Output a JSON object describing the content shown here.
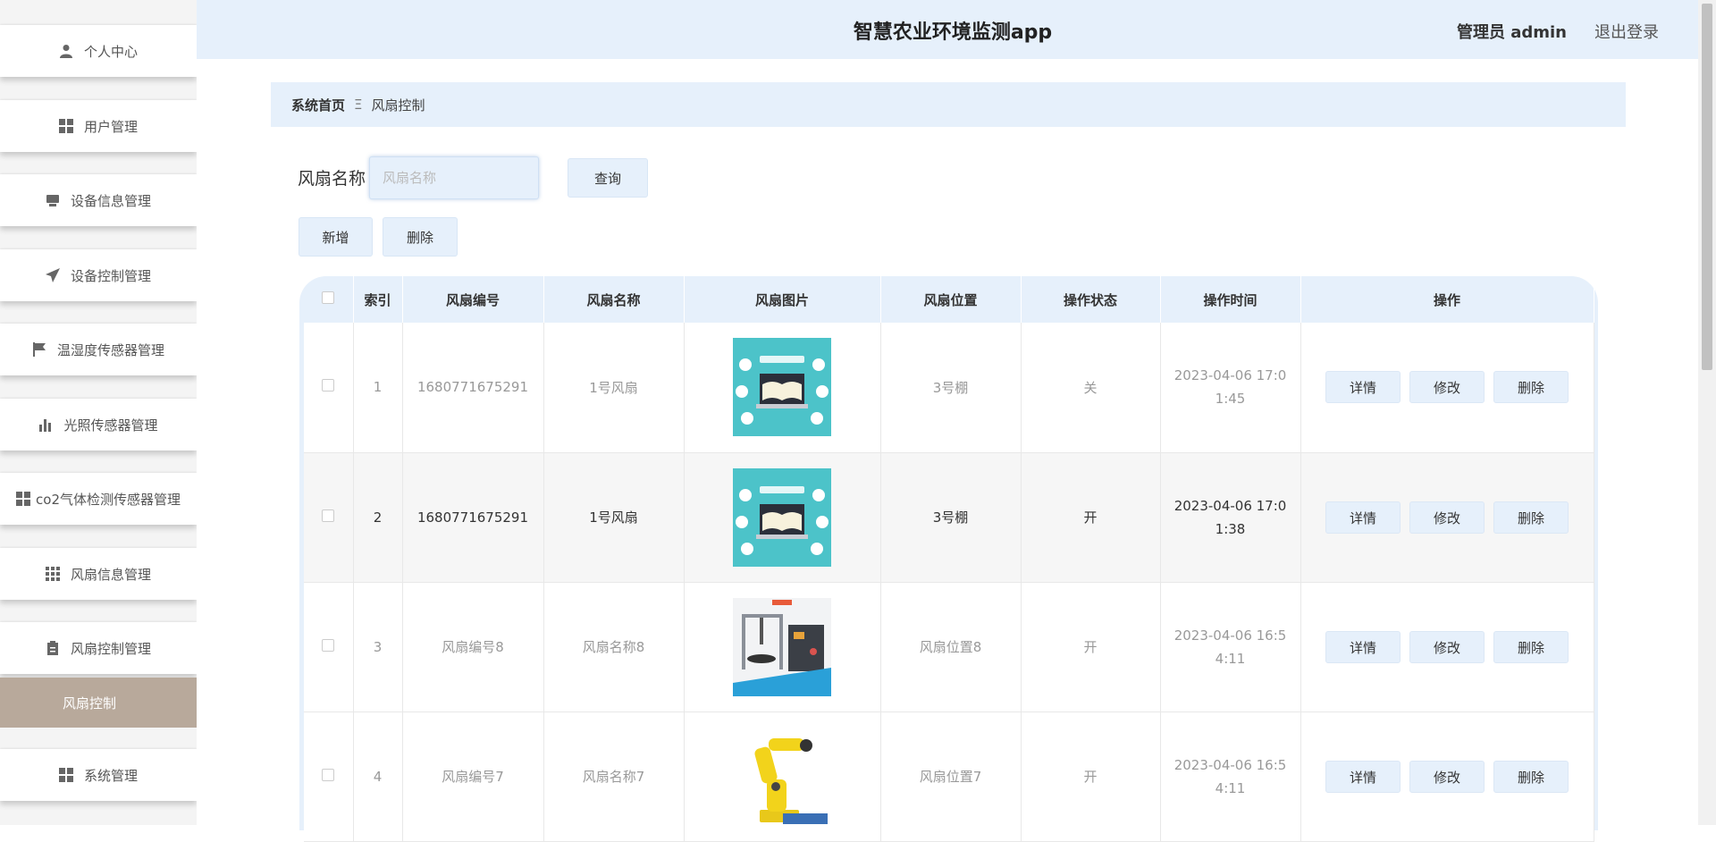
{
  "sidebar": {
    "items": [
      {
        "label": "个人中心",
        "icon": "person-icon"
      },
      {
        "label": "用户管理",
        "icon": "grid-icon"
      },
      {
        "label": "设备信息管理",
        "icon": "monitor-icon"
      },
      {
        "label": "设备控制管理",
        "icon": "send-icon"
      },
      {
        "label": "温湿度传感器管理",
        "icon": "flag-icon"
      },
      {
        "label": "光照传感器管理",
        "icon": "bar-chart-icon"
      },
      {
        "label": "co2气体检测传感器管理",
        "icon": "grid-icon"
      },
      {
        "label": "风扇信息管理",
        "icon": "apps-icon"
      },
      {
        "label": "风扇控制管理",
        "icon": "clipboard-icon"
      }
    ],
    "active_sub": "风扇控制",
    "last_item": {
      "label": "系统管理",
      "icon": "grid-icon"
    }
  },
  "header": {
    "title": "智慧农业环境监测app",
    "user": "管理员 admin",
    "logout": "退出登录"
  },
  "breadcrumb": {
    "home": "系统首页",
    "separator": "Ξ",
    "current": "风扇控制"
  },
  "search": {
    "label": "风扇名称",
    "placeholder": "风扇名称",
    "button": "查询"
  },
  "actions": {
    "add": "新增",
    "delete": "删除"
  },
  "table": {
    "headers": [
      "索引",
      "风扇编号",
      "风扇名称",
      "风扇图片",
      "风扇位置",
      "操作状态",
      "操作时间",
      "操作"
    ],
    "rows": [
      {
        "index": "1",
        "code": "1680771675291",
        "name": "1号风扇",
        "image": "online-education-image",
        "location": "3号棚",
        "status": "关",
        "time": "2023-04-06 17:01:45"
      },
      {
        "index": "2",
        "code": "1680771675291",
        "name": "1号风扇",
        "image": "online-education-image",
        "location": "3号棚",
        "status": "开",
        "time": "2023-04-06 17:01:38"
      },
      {
        "index": "3",
        "code": "风扇编号8",
        "name": "风扇名称8",
        "image": "lab-device-image",
        "location": "风扇位置8",
        "status": "开",
        "time": "2023-04-06 16:54:11"
      },
      {
        "index": "4",
        "code": "风扇编号7",
        "name": "风扇名称7",
        "image": "robot-arm-image",
        "location": "风扇位置7",
        "status": "开",
        "time": "2023-04-06 16:54:11"
      }
    ],
    "row_actions": {
      "detail": "详情",
      "edit": "修改",
      "delete": "删除"
    }
  },
  "colors": {
    "accent": "#e6f0fb",
    "active_menu": "#b8a99b"
  }
}
